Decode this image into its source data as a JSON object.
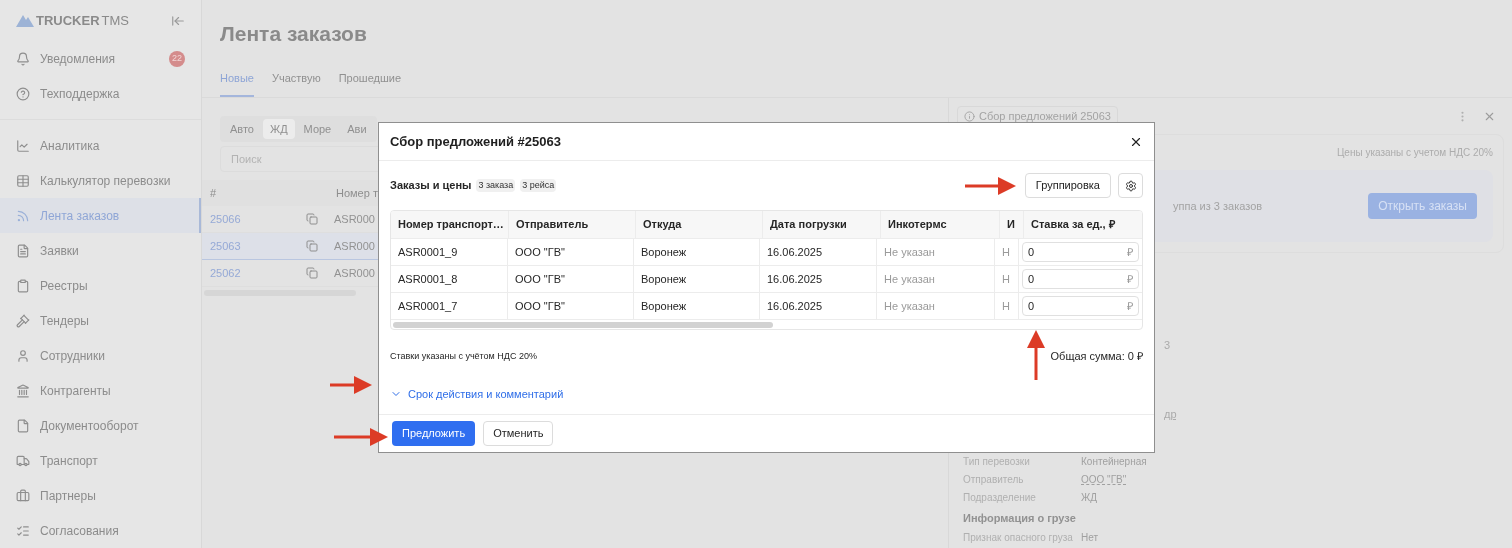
{
  "sidebar": {
    "logo": {
      "brand": "TRUCKER",
      "suffix": "TMS"
    },
    "top_items": [
      {
        "label": "Уведомления",
        "badge": "22"
      },
      {
        "label": "Техподдержка"
      }
    ],
    "items": [
      {
        "label": "Аналитика",
        "selected": false
      },
      {
        "label": "Калькулятор перевозки",
        "selected": false
      },
      {
        "label": "Лента заказов",
        "selected": true
      },
      {
        "label": "Заявки",
        "selected": false
      },
      {
        "label": "Реестры",
        "selected": false
      },
      {
        "label": "Тендеры",
        "selected": false
      },
      {
        "label": "Сотрудники",
        "selected": false
      },
      {
        "label": "Контрагенты",
        "selected": false
      },
      {
        "label": "Документооборот",
        "selected": false
      },
      {
        "label": "Транспорт",
        "selected": false
      },
      {
        "label": "Партнеры",
        "selected": false
      },
      {
        "label": "Согласования",
        "selected": false
      }
    ]
  },
  "page": {
    "title": "Лента заказов",
    "tabs": [
      {
        "label": "Новые",
        "selected": true
      },
      {
        "label": "Участвую",
        "selected": false
      },
      {
        "label": "Прошедшие",
        "selected": false
      }
    ],
    "segments": [
      {
        "label": "Авто",
        "selected": false
      },
      {
        "label": "ЖД",
        "selected": true
      },
      {
        "label": "Море",
        "selected": false
      },
      {
        "label": "Ави",
        "selected": false
      }
    ],
    "search": {
      "placeholder": "Поиск"
    },
    "table": {
      "columns": [
        "#",
        "Номер т"
      ],
      "rows": [
        {
          "id": "25066",
          "number": "ASR000",
          "selected": false
        },
        {
          "id": "25063",
          "number": "ASR000",
          "selected": true
        },
        {
          "id": "25062",
          "number": "ASR000",
          "selected": false
        }
      ]
    }
  },
  "detail_panel": {
    "chip": "Сбор предложений 25063",
    "vat_note": "Цены указаны с учетом НДС 20%",
    "group_text": "уппа из 3 заказов",
    "open_button": "Открыть заказы",
    "fragments": [
      "3",
      "др"
    ],
    "fields": [
      {
        "label": "Тип перевозки",
        "value": "Контейнерная",
        "kind": "text"
      },
      {
        "label": "Отправитель",
        "value": "ООО \"ГВ\"",
        "kind": "link"
      },
      {
        "label": "Подразделение",
        "value": "ЖД",
        "kind": "text"
      }
    ],
    "section": "Информация о грузе",
    "cargo_fields": [
      {
        "label": "Признак опасного груза",
        "value": "Нет"
      }
    ]
  },
  "dialog": {
    "title": "Сбор предложений #25063",
    "section_title": "Заказы и цены",
    "tags": [
      "3 заказа",
      "3 рейса"
    ],
    "group_button": "Группировка",
    "columns": [
      "Номер транспорт…",
      "Отправитель",
      "Откуда",
      "Дата погрузки",
      "Инкотермс",
      "И",
      "Ставка за ед., ₽"
    ],
    "rows": [
      {
        "cells": [
          "ASR0001_9",
          "ООО \"ГВ\"",
          "Воронеж",
          "16.06.2025",
          "Не указан",
          "Н"
        ],
        "rate": "0",
        "currency": "₽"
      },
      {
        "cells": [
          "ASR0001_8",
          "ООО \"ГВ\"",
          "Воронеж",
          "16.06.2025",
          "Не указан",
          "Н"
        ],
        "rate": "0",
        "currency": "₽"
      },
      {
        "cells": [
          "ASR0001_7",
          "ООО \"ГВ\"",
          "Воронеж",
          "16.06.2025",
          "Не указан",
          "Н"
        ],
        "rate": "0",
        "currency": "₽"
      }
    ],
    "vat_note": "Ставки указаны с учётом НДС 20%",
    "total": "Общая сумма: 0 ₽",
    "expander": {
      "label": "Срок действия и комментарий",
      "expanded": false
    },
    "submit": "Предложить",
    "cancel": "Отменить"
  }
}
